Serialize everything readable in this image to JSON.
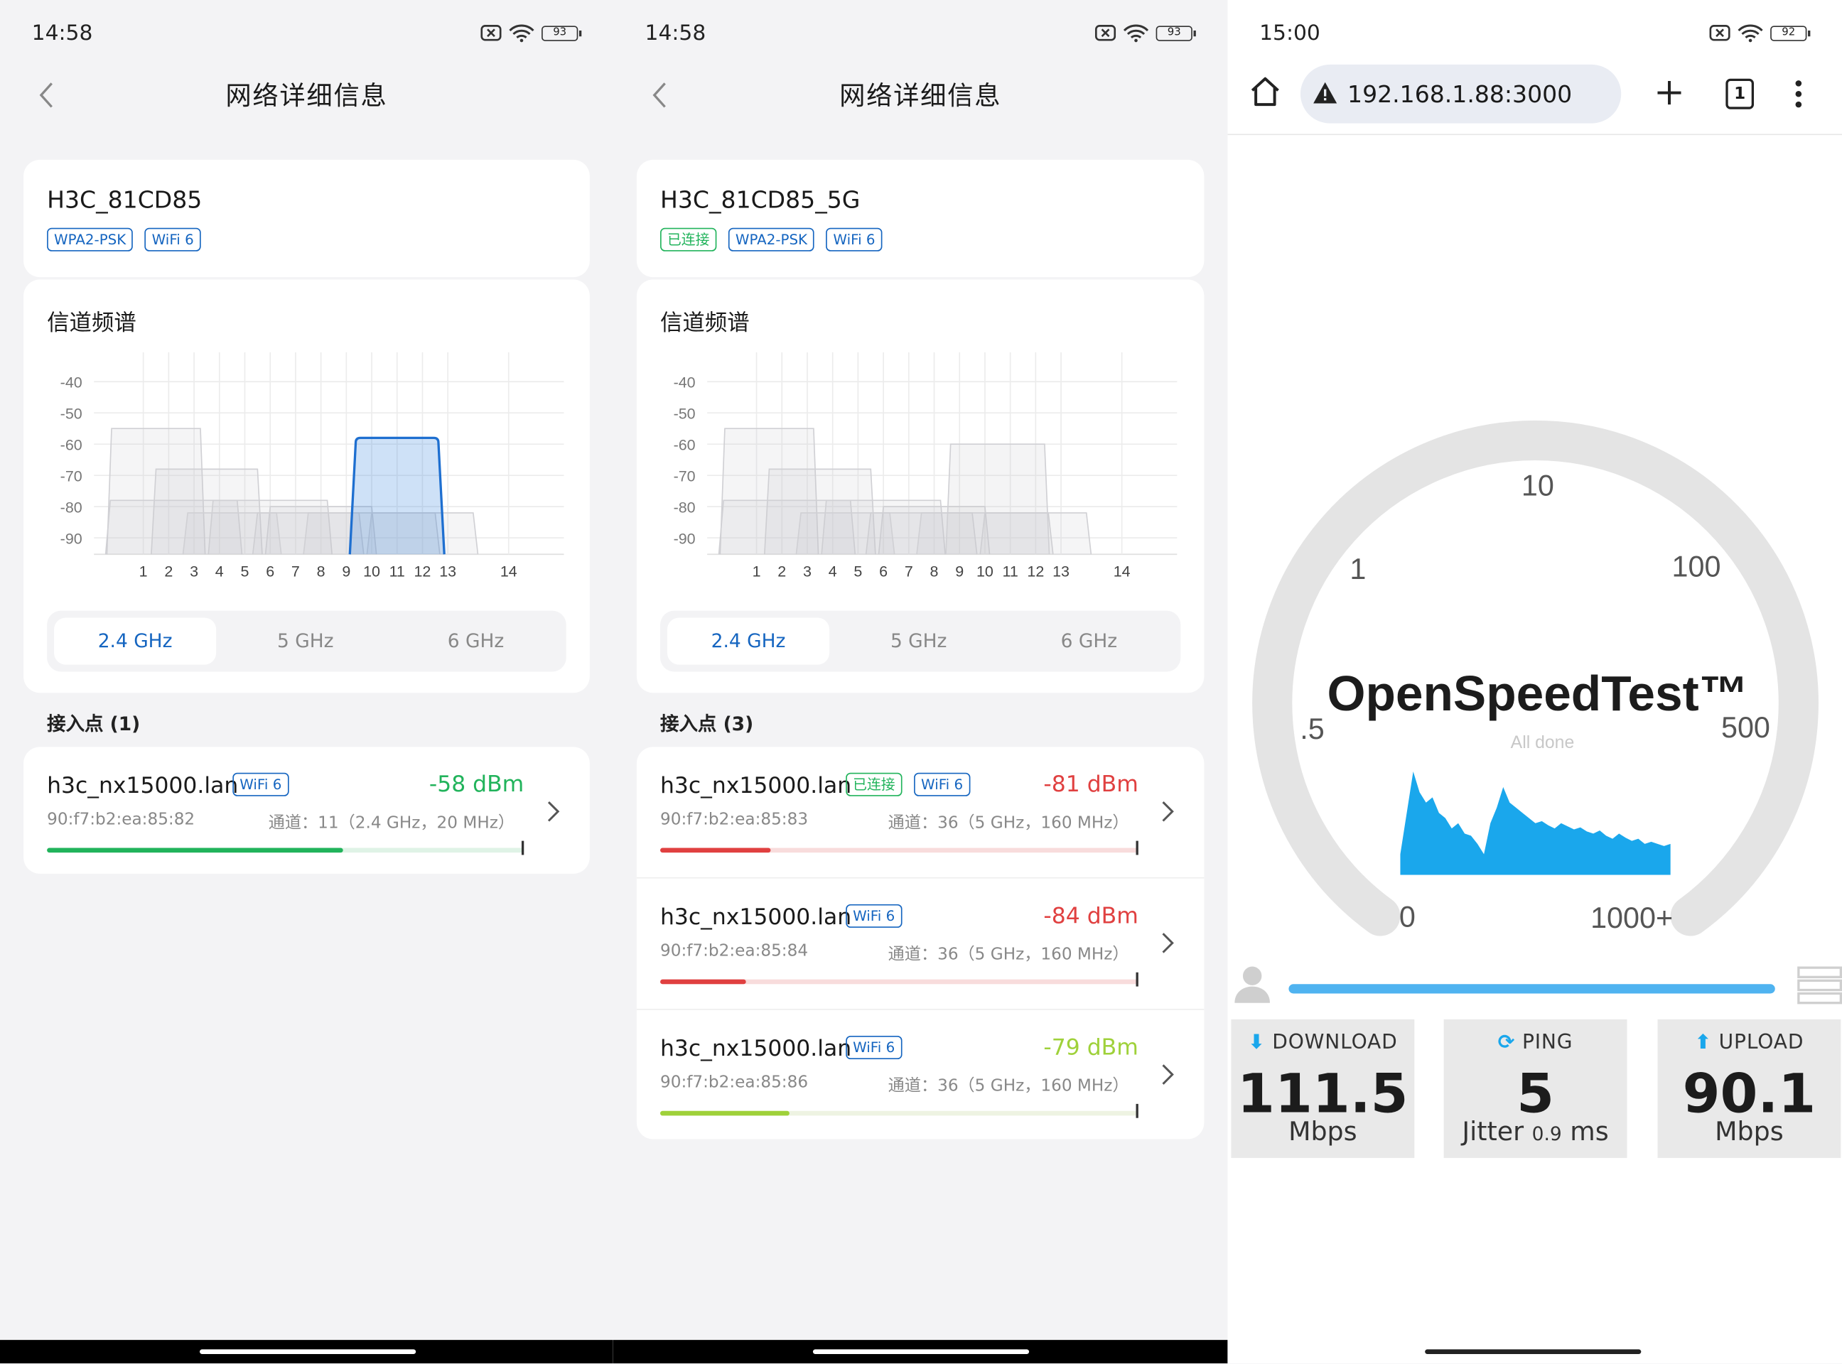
{
  "panel1": {
    "time": "14:58",
    "battery": "93",
    "title": "网络详细信息",
    "ssid": "H3C_81CD85",
    "tags": [
      "WPA2-PSK",
      "WiFi 6"
    ],
    "spectrum_title": "信道频谱",
    "y_labels": [
      "-40",
      "-50",
      "-60",
      "-70",
      "-80",
      "-90"
    ],
    "x_labels": [
      "1",
      "2",
      "3",
      "4",
      "5",
      "6",
      "7",
      "8",
      "9",
      "10",
      "11",
      "12",
      "13",
      "14"
    ],
    "bands": [
      "2.4 GHz",
      "5 GHz",
      "6 GHz"
    ],
    "ap_heading": "接入点 (1)",
    "aps": [
      {
        "name": "h3c_nx15000.lan",
        "tags": [
          "WiFi 6"
        ],
        "dbm": "-58 dBm",
        "mac": "90:f7:b2:ea:85:82",
        "channel": "通道：11（2.4 GHz，20 MHz）",
        "level": 0.62,
        "color": "#21b35b",
        "track": "#dff3e6"
      }
    ]
  },
  "panel2": {
    "time": "14:58",
    "battery": "93",
    "title": "网络详细信息",
    "ssid": "H3C_81CD85_5G",
    "tags_connected": "已连接",
    "tags": [
      "WPA2-PSK",
      "WiFi 6"
    ],
    "spectrum_title": "信道频谱",
    "y_labels": [
      "-40",
      "-50",
      "-60",
      "-70",
      "-80",
      "-90"
    ],
    "x_labels": [
      "1",
      "2",
      "3",
      "4",
      "5",
      "6",
      "7",
      "8",
      "9",
      "10",
      "11",
      "12",
      "13",
      "14"
    ],
    "bands": [
      "2.4 GHz",
      "5 GHz",
      "6 GHz"
    ],
    "ap_heading": "接入点 (3)",
    "aps": [
      {
        "name": "h3c_nx15000.lan",
        "connected": "已连接",
        "tags": [
          "WiFi 6"
        ],
        "dbm": "-81 dBm",
        "mac": "90:f7:b2:ea:85:83",
        "channel": "通道：36（5 GHz，160 MHz）",
        "level": 0.23,
        "color": "#e04040",
        "track": "#f8dcdc"
      },
      {
        "name": "h3c_nx15000.lan",
        "tags": [
          "WiFi 6"
        ],
        "dbm": "-84 dBm",
        "mac": "90:f7:b2:ea:85:84",
        "channel": "通道：36（5 GHz，160 MHz）",
        "level": 0.18,
        "color": "#e04040",
        "track": "#f8dcdc"
      },
      {
        "name": "h3c_nx15000.lan",
        "tags": [
          "WiFi 6"
        ],
        "dbm": "-79 dBm",
        "mac": "90:f7:b2:ea:85:86",
        "channel": "通道：36（5 GHz，160 MHz）",
        "level": 0.27,
        "color": "#9fd13a",
        "track": "#eef3e2"
      }
    ]
  },
  "panel3": {
    "time": "15:00",
    "battery": "92",
    "url": "192.168.1.88:3000",
    "tab_count": "1",
    "gauge_labels": {
      "l0": "0",
      "l05": ".5",
      "l1": "1",
      "l10": "10",
      "l100": "100",
      "l500": "500",
      "l1000": "1000+"
    },
    "brand": "OpenSpeedTest™",
    "status": "All done",
    "download": {
      "label": "DOWNLOAD",
      "value": "111.5",
      "unit": "Mbps"
    },
    "ping": {
      "label": "PING",
      "value": "5",
      "jitter_label": "Jitter",
      "jitter_value": "0.9",
      "unit": "ms"
    },
    "upload": {
      "label": "UPLOAD",
      "value": "90.1",
      "unit": "Mbps"
    },
    "accent": "#1aa7ec"
  }
}
